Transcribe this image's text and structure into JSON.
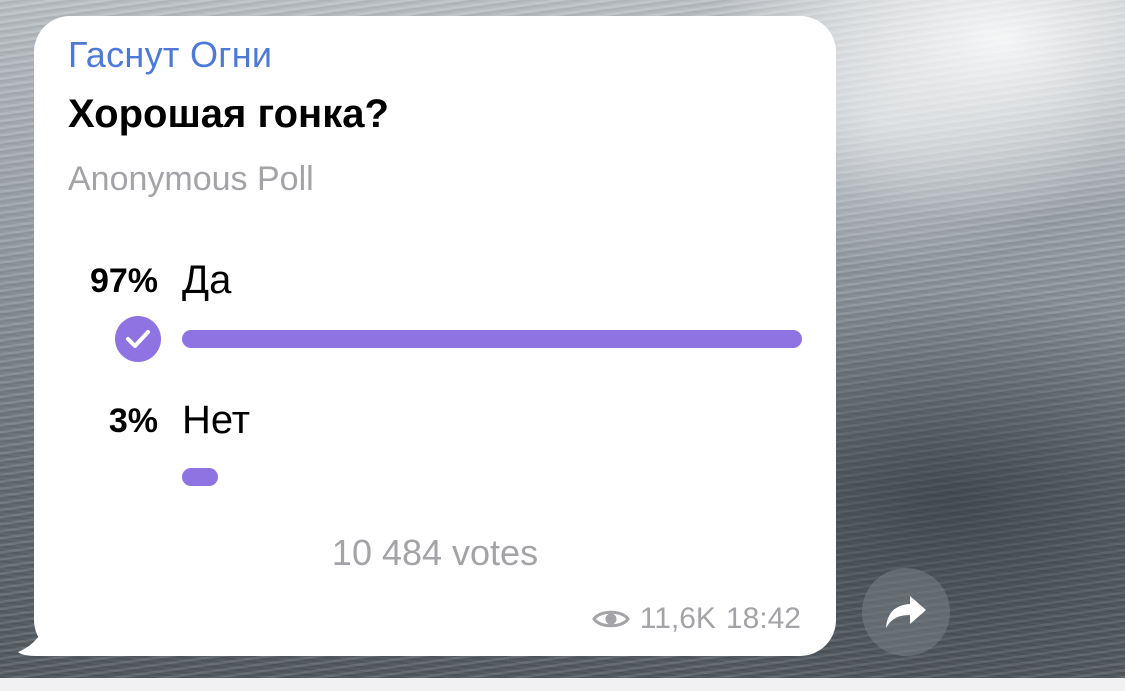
{
  "channel": {
    "name": "Гаснут Огни"
  },
  "poll": {
    "question": "Хорошая гонка?",
    "type": "Anonymous Poll",
    "options": [
      {
        "percent_label": "97%",
        "label": "Да",
        "fraction": 0.97,
        "selected": true
      },
      {
        "percent_label": "3%",
        "label": "Нет",
        "fraction": 0.03,
        "selected": false
      }
    ],
    "total_votes": "10 484 votes"
  },
  "message": {
    "views": "11,6K",
    "time": "18:42"
  },
  "colors": {
    "accent": "#8e74e2",
    "channel_name": "#4d7ad8",
    "secondary_text": "#a3a3a8",
    "bubble": "#ffffff"
  },
  "icons": {
    "selected": "checkmark-icon",
    "views": "eye-icon",
    "share": "share-arrow-icon"
  }
}
